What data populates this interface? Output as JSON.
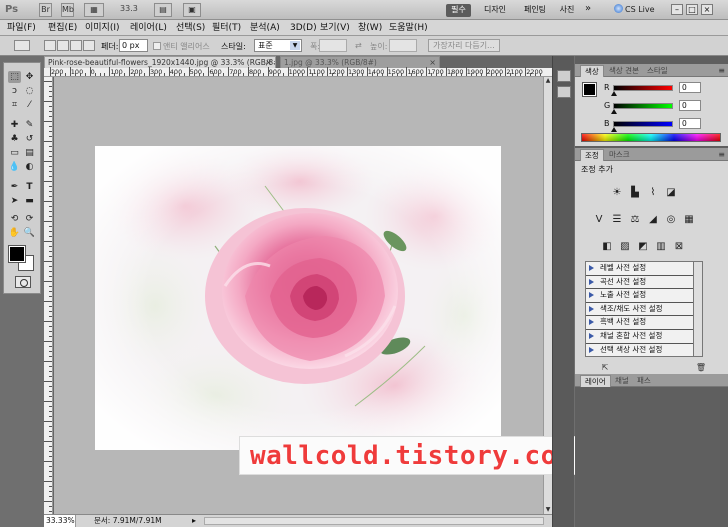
{
  "app": {
    "logo": "Ps",
    "buttons": [
      "Br",
      "Mb"
    ],
    "zoom": "33.3",
    "workspaces": [
      "필수",
      "디자인",
      "페인팅",
      "사진"
    ],
    "active_workspace": "필수",
    "more": "»",
    "cs_live": "CS Live",
    "window_controls": [
      "–",
      "□",
      "×"
    ]
  },
  "menu": {
    "items": [
      "파일(F)",
      "편집(E)",
      "이미지(I)",
      "레이어(L)",
      "선택(S)",
      "필터(T)",
      "분석(A)",
      "3D(D)",
      "보기(V)",
      "창(W)",
      "도움말(H)"
    ]
  },
  "options": {
    "feather_label": "페더:",
    "feather_value": "0 px",
    "antialias_label": "앤티 앨리어스",
    "style_label": "스타일:",
    "style_value": "표준",
    "width_label": "폭:",
    "height_label": "높이:",
    "refine_edge": "가장자리 다듬기..."
  },
  "documents": {
    "tabs": [
      {
        "title": "Pink-rose-beautiful-flowers_1920x1440.jpg @ 33.3% (RGB/8#)",
        "close": "×",
        "active": true
      },
      {
        "title": "1.jpg @ 33.3% (RGB/8#)",
        "close": "×",
        "active": false
      }
    ],
    "ruler_numbers": [
      "200",
      "100",
      "0",
      "100",
      "200",
      "300",
      "400",
      "500",
      "600",
      "700",
      "800",
      "900",
      "1000",
      "1100",
      "1200",
      "1300",
      "1400",
      "1500",
      "1600",
      "1700",
      "1800",
      "1900",
      "2000",
      "2100",
      "2200"
    ],
    "status_zoom": "33.33%",
    "status_doc": "문서: 7.91M/7.91M",
    "status_arrow": "▸"
  },
  "watermark": {
    "text": "wallcold.tistory.com"
  },
  "panels": {
    "color_tabs": [
      "색상",
      "색상 견본",
      "스타일"
    ],
    "color": {
      "channels": [
        {
          "label": "R",
          "value": "0",
          "track": "linear-gradient(to right,#000,#ff0000)"
        },
        {
          "label": "G",
          "value": "0",
          "track": "linear-gradient(to right,#000,#00ff00)"
        },
        {
          "label": "B",
          "value": "0",
          "track": "linear-gradient(to right,#000,#0000ff)"
        }
      ]
    },
    "adjust_tabs": [
      "조정",
      "마스크"
    ],
    "adjust_title": "조정 추가",
    "presets": [
      "레벨 사전 설정",
      "곡선 사전 설정",
      "노출 사전 설정",
      "색조/채도 사전 설정",
      "흑백 사전 설정",
      "채널 혼합 사전 설정",
      "선택 색상 사전 설정"
    ],
    "layer_tabs": [
      "레이어",
      "채널",
      "패스"
    ],
    "menu_icon": "≡"
  }
}
